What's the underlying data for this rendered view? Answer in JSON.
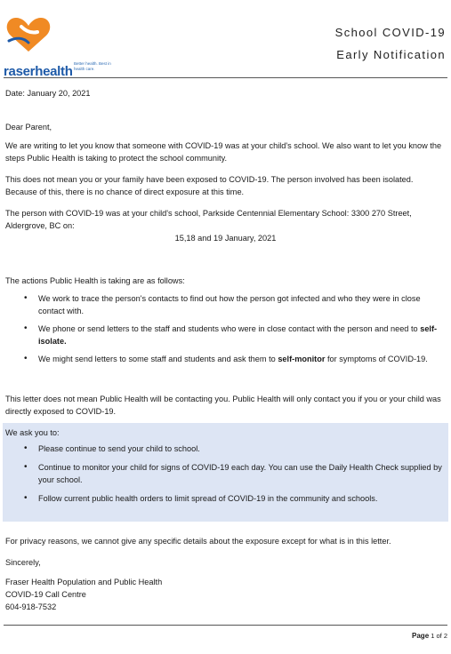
{
  "header": {
    "logo_brand": "raserhealth",
    "logo_tagline": "Better health. Best in health care.",
    "title_line1": "School COVID-19",
    "title_line2": "Early Notification"
  },
  "date": "Date: January 20, 2021",
  "greeting": "Dear Parent,",
  "para1": "We are writing to let you know that someone with COVID-19 was at your child's school. We also want to let you know the steps Public Health is taking to protect the school community.",
  "para2": "This does not mean you or your family have been exposed to COVID-19. The person involved has been isolated. Because of this, there is no chance of direct exposure at this time.",
  "para3": "The person with COVID-19 was at your child's school, Parkside Centennial Elementary School:  3300 270 Street, Aldergrove, BC on:",
  "dates": "15,18 and 19 January, 2021",
  "actions_intro": "The actions Public Health is taking are as follows:",
  "actions": [
    {
      "text": "We work to trace the person's contacts to find out how the person got infected and who they were in close contact with."
    },
    {
      "text": "We phone or send letters to the staff and students who were in close contact with the person and need to ",
      "bold": "self-isolate.",
      "after": ""
    },
    {
      "text": "We might send letters to some staff and students and ask them to ",
      "bold": "self-monitor",
      "after": " for symptoms of COVID-19."
    }
  ],
  "para4": "This letter does not mean Public Health will be contacting you. Public Health will only contact you if you or your child was directly exposed to COVID-19.",
  "ask_intro": "We ask you to:",
  "asks": [
    "Please continue to send your child to school.",
    "Continue to monitor your child for signs of COVID-19 each day.  You can use the Daily Health Check supplied by your school.",
    "Follow current public health orders to limit spread of COVID-19 in the community and schools."
  ],
  "privacy": "For privacy reasons, we cannot give any specific details about the exposure except for what is in this letter.",
  "closing": "Sincerely,",
  "signature": {
    "line1": "Fraser Health Population and Public Health",
    "line2": "COVID-19 Call Centre",
    "line3": "604-918-7532"
  },
  "page_label": "Page",
  "page_of": "1 of 2",
  "colors": {
    "logo_orange": "#f08a24",
    "logo_blue": "#1e5aa8",
    "ask_box_bg": "#dde5f4"
  }
}
